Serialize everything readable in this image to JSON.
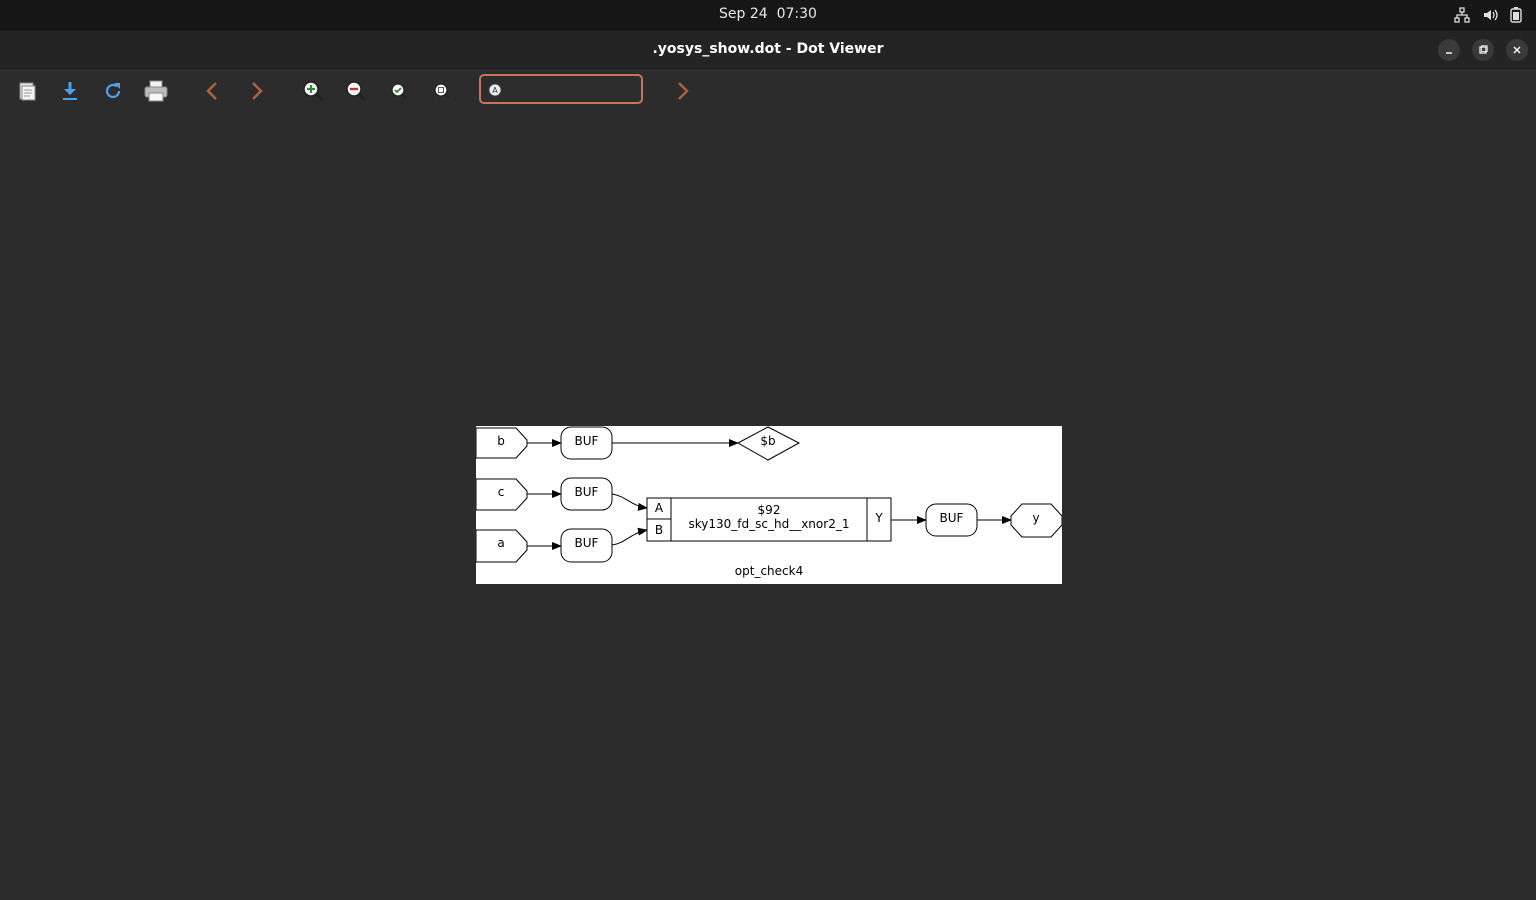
{
  "system": {
    "date": "Sep 24",
    "time": "07:30",
    "tray_icons": [
      "network-icon",
      "volume-icon",
      "battery-icon"
    ]
  },
  "window": {
    "title": ".yosys_show.dot - Dot Viewer",
    "controls": [
      "minimize-icon",
      "maximize-icon",
      "close-icon"
    ]
  },
  "toolbar": {
    "buttons": [
      "open-icon",
      "save-icon",
      "reload-icon",
      "print-icon",
      "back-icon",
      "forward-icon",
      "zoom-in-icon",
      "zoom-out-icon",
      "zoom-fit-icon",
      "zoom-100-icon"
    ],
    "search": {
      "value": "",
      "placeholder": ""
    },
    "find_next": "find-next-icon"
  },
  "graph": {
    "name": "opt_check4",
    "inputs": {
      "b": "b",
      "c": "c",
      "a": "a"
    },
    "buffers": {
      "buf_b": "BUF",
      "buf_c": "BUF",
      "buf_a": "BUF",
      "buf_y": "BUF"
    },
    "wire": "$b",
    "cell": {
      "id": "$92",
      "type": "sky130_fd_sc_hd__xnor2_1",
      "port_a": "A",
      "port_b": "B",
      "port_y": "Y"
    },
    "output": "y"
  },
  "colors": {
    "accent": "#c7755a",
    "panel_bg": "#2c2c2c",
    "top_bar": "#171717"
  }
}
